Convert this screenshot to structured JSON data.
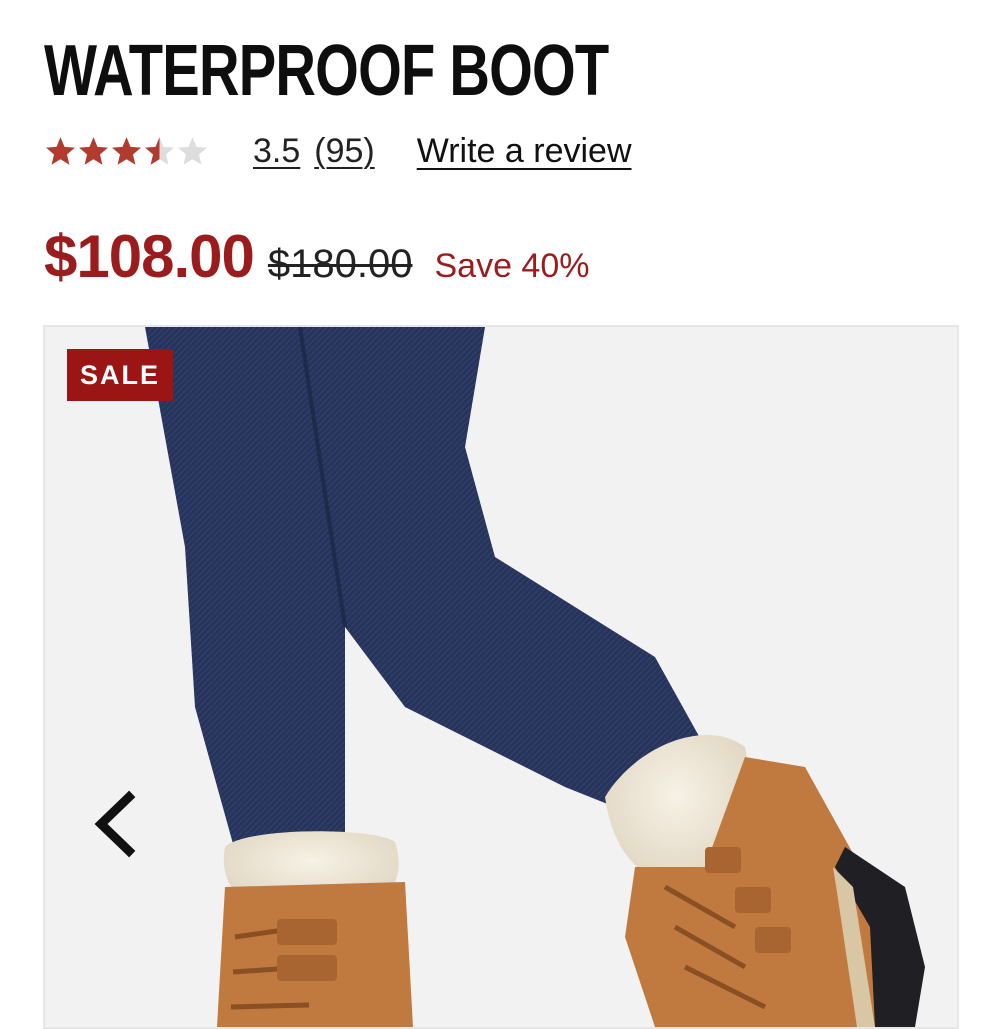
{
  "product": {
    "title": "WATERPROOF BOOT",
    "rating": {
      "stars_value": 3.5,
      "stars_max": 5,
      "score_label": "3.5",
      "count_label": "(95)",
      "write_review_label": "Write a review"
    },
    "price": {
      "current": "$108.00",
      "original": "$180.00",
      "savings": "Save 40%"
    },
    "gallery": {
      "badge": "SALE",
      "prev_icon": "chevron-left-icon"
    }
  },
  "colors": {
    "accent": "#9b1c1c",
    "star_filled": "#b23a2e",
    "star_empty": "#dddddd",
    "badge_bg": "#9b1515"
  }
}
